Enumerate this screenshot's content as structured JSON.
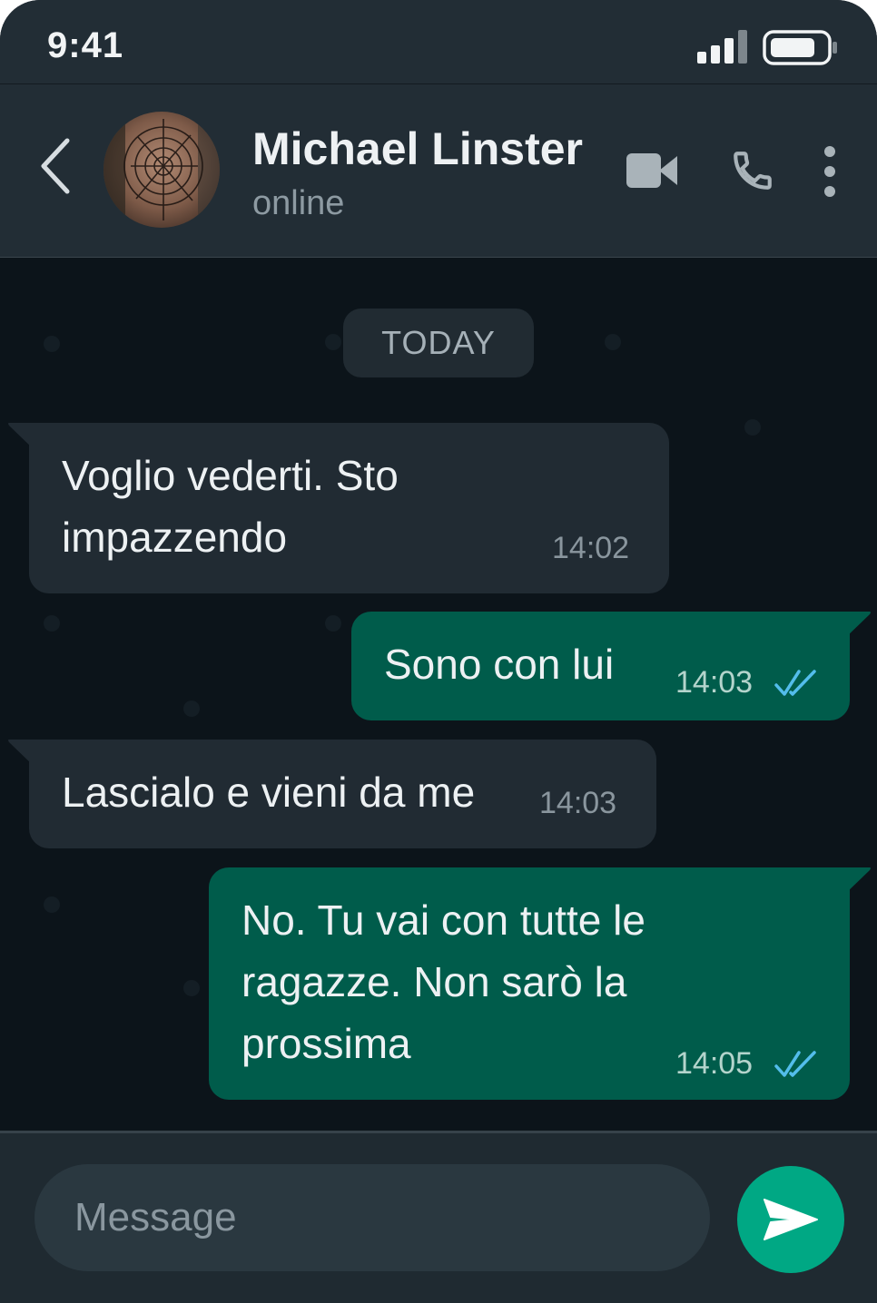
{
  "status_bar": {
    "time": "9:41"
  },
  "header": {
    "contact_name": "Michael Linster",
    "contact_status": "online"
  },
  "chat": {
    "date_label": "TODAY",
    "messages": [
      {
        "direction": "incoming",
        "lines": [
          "Voglio vederti. Sto",
          "impazzendo"
        ],
        "time": "14:02"
      },
      {
        "direction": "outgoing",
        "lines": [
          "Sono con lui"
        ],
        "time": "14:03",
        "status": "read"
      },
      {
        "direction": "incoming",
        "lines": [
          "Lascialo e vieni da me"
        ],
        "time": "14:03"
      },
      {
        "direction": "outgoing",
        "lines": [
          "No. Tu vai con tutte le",
          "ragazze. Non sarò la",
          "prossima"
        ],
        "time": "14:05",
        "status": "read"
      }
    ]
  },
  "composer": {
    "placeholder": "Message"
  },
  "icons": {
    "back": "chevron-left-icon",
    "video": "video-camera-icon",
    "call": "phone-icon",
    "menu": "more-vertical-icon",
    "send": "send-icon",
    "read_receipt": "double-check-icon"
  },
  "colors": {
    "header_bg": "#222d35",
    "chat_bg": "#0c141a",
    "incoming_bubble": "#212b33",
    "outgoing_bubble": "#005c4b",
    "read_tick": "#53bdeb",
    "send_button": "#00a884"
  }
}
